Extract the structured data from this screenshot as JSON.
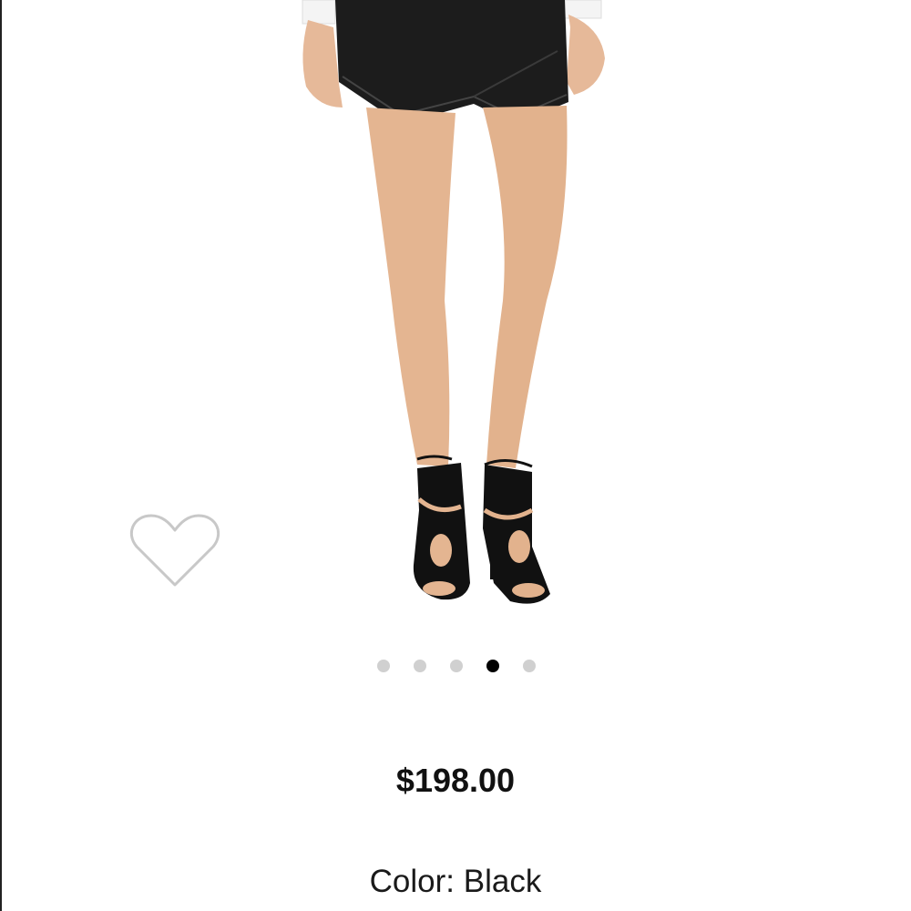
{
  "product": {
    "image_name": "leather-skort-and-cutout-heels-photo",
    "price": "$198.00",
    "color_label": "Color:",
    "color_value": "Black"
  },
  "favorite": {
    "icon": "heart-outline-icon",
    "color": "#c8c8c8"
  },
  "carousel": {
    "total_slides": 5,
    "active_index": 3,
    "active_color": "#000000",
    "inactive_color": "#d0d0d0"
  }
}
